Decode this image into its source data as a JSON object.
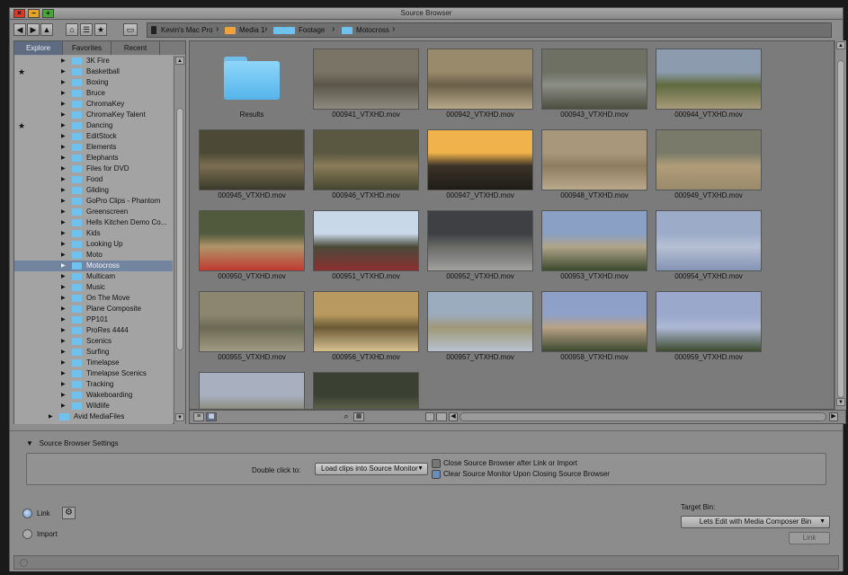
{
  "window": {
    "title": "Source Browser"
  },
  "breadcrumb": [
    {
      "label": "Kevin's Mac Pro",
      "icon": "hard-drive-icon"
    },
    {
      "label": "Media 1",
      "icon": "folder-orange-icon"
    },
    {
      "label": "",
      "icon": "folder-icon"
    },
    {
      "label": "Footage",
      "icon": "folder-icon"
    },
    {
      "label": "Motocross",
      "icon": "folder-icon"
    }
  ],
  "tabs": [
    "Explore",
    "Favorites",
    "Recent"
  ],
  "tree": [
    {
      "label": "3K Fire",
      "star": false
    },
    {
      "label": "Basketball",
      "star": true
    },
    {
      "label": "Boxing",
      "star": false
    },
    {
      "label": "Bruce",
      "star": false
    },
    {
      "label": "ChromaKey",
      "star": false
    },
    {
      "label": "ChromaKey Talent",
      "star": false
    },
    {
      "label": "Dancing",
      "star": true
    },
    {
      "label": "EditStock",
      "star": false
    },
    {
      "label": "Elements",
      "star": false
    },
    {
      "label": "Elephants",
      "star": false
    },
    {
      "label": "Files for DVD",
      "star": false
    },
    {
      "label": "Food",
      "star": false
    },
    {
      "label": "Gliding",
      "star": false
    },
    {
      "label": "GoPro Clips - Phantom",
      "star": false
    },
    {
      "label": "Greenscreen",
      "star": false
    },
    {
      "label": "Hells Kitchen Demo Co...",
      "star": false
    },
    {
      "label": "Kids",
      "star": false
    },
    {
      "label": "Looking Up",
      "star": false
    },
    {
      "label": "Moto",
      "star": false
    },
    {
      "label": "Motocross",
      "star": false,
      "selected": true
    },
    {
      "label": "Multicam",
      "star": false
    },
    {
      "label": "Music",
      "star": false
    },
    {
      "label": "On The Move",
      "star": false
    },
    {
      "label": "Plane Composite",
      "star": false
    },
    {
      "label": "PP101",
      "star": false
    },
    {
      "label": "ProRes 4444",
      "star": false
    },
    {
      "label": "Scenics",
      "star": false
    },
    {
      "label": "Surfing",
      "star": false
    },
    {
      "label": "Timelapse",
      "star": false
    },
    {
      "label": "Timelapse Scenics",
      "star": false
    },
    {
      "label": "Tracking",
      "star": false
    },
    {
      "label": "Wakeboarding",
      "star": false
    },
    {
      "label": "Wildlife",
      "star": false
    },
    {
      "label": "Avid MediaFiles",
      "star": false,
      "outdent": true
    }
  ],
  "items": [
    {
      "name": "Results",
      "type": "folder"
    },
    {
      "name": "000941_VTXHD.mov",
      "type": "clip",
      "colors": [
        "#7a7466",
        "#5b5648",
        "#8e8a80"
      ]
    },
    {
      "name": "000942_VTXHD.mov",
      "type": "clip",
      "colors": [
        "#9a8a6c",
        "#6b5f48",
        "#b7a88a"
      ]
    },
    {
      "name": "000943_VTXHD.mov",
      "type": "clip",
      "colors": [
        "#6d7062",
        "#8c8e86",
        "#4d4f40"
      ]
    },
    {
      "name": "000944_VTXHD.mov",
      "type": "clip",
      "colors": [
        "#8c9cae",
        "#5f6a3e",
        "#a79a7a"
      ]
    },
    {
      "name": "000945_VTXHD.mov",
      "type": "clip",
      "colors": [
        "#4c4a36",
        "#7b6e52",
        "#3a3a2a"
      ]
    },
    {
      "name": "000946_VTXHD.mov",
      "type": "clip",
      "colors": [
        "#5a5840",
        "#8a7c5a",
        "#45462f"
      ]
    },
    {
      "name": "000947_VTXHD.mov",
      "type": "clip",
      "colors": [
        "#f0b24a",
        "#3a3328",
        "#1f1c18"
      ]
    },
    {
      "name": "000948_VTXHD.mov",
      "type": "clip",
      "colors": [
        "#a8977a",
        "#8d7c60",
        "#b9a88c"
      ]
    },
    {
      "name": "000949_VTXHD.mov",
      "type": "clip",
      "colors": [
        "#7a7a6a",
        "#b09c78",
        "#9a8a6c"
      ]
    },
    {
      "name": "000950_VTXHD.mov",
      "type": "clip",
      "colors": [
        "#525a3e",
        "#b0956a",
        "#c03a30"
      ]
    },
    {
      "name": "000951_VTXHD.mov",
      "type": "clip",
      "colors": [
        "#c8d8e8",
        "#4a4a3a",
        "#8c3030"
      ]
    },
    {
      "name": "000952_VTXHD.mov",
      "type": "clip",
      "colors": [
        "#3e4044",
        "#6a6a66",
        "#a0a0a0"
      ]
    },
    {
      "name": "000953_VTXHD.mov",
      "type": "clip",
      "colors": [
        "#8aa0c4",
        "#b0a48a",
        "#3d4a2e"
      ]
    },
    {
      "name": "000954_VTXHD.mov",
      "type": "clip",
      "colors": [
        "#9cacc8",
        "#b6c0d4",
        "#8494b4"
      ]
    },
    {
      "name": "000955_VTXHD.mov",
      "type": "clip",
      "colors": [
        "#8c8670",
        "#6c6a54",
        "#a09a84"
      ]
    },
    {
      "name": "000956_VTXHD.mov",
      "type": "clip",
      "colors": [
        "#b89a60",
        "#6a5a36",
        "#d8c090"
      ]
    },
    {
      "name": "000957_VTXHD.mov",
      "type": "clip",
      "colors": [
        "#9cacbf",
        "#a09878",
        "#b8c2d0"
      ]
    },
    {
      "name": "000958_VTXHD.mov",
      "type": "clip",
      "colors": [
        "#8ea0c8",
        "#b8a286",
        "#3e4a30"
      ]
    },
    {
      "name": "000959_VTXHD.mov",
      "type": "clip",
      "colors": [
        "#9aa8cc",
        "#aeb8d4",
        "#3c4a2e"
      ]
    },
    {
      "name": "",
      "type": "clip",
      "colors": [
        "#a8b0c0",
        "#8c8c80",
        "#c0c4cc"
      ]
    },
    {
      "name": "",
      "type": "clip",
      "colors": [
        "#3a4032",
        "#5a6048",
        "#2a2e24"
      ]
    }
  ],
  "settings": {
    "heading": "Source Browser Settings",
    "double_click_label": "Double click to:",
    "double_click_value": "Load clips into Source Monitor",
    "check1": "Close Source Browser after Link or Import",
    "check2": "Clear Source Monitor Upon Closing Source Browser",
    "radio_link": "Link",
    "radio_import": "Import",
    "target_bin_label": "Target Bin:",
    "target_bin_value": "Lets Edit with Media Composer Bin",
    "link_button": "Link"
  },
  "toolbar": {
    "back": "◀",
    "forward": "▶",
    "up": "▲",
    "home": "⌂",
    "list": "☰",
    "star": "★",
    "drive": "▭"
  },
  "window_buttons": {
    "close": "×",
    "minimize": "−",
    "zoom": "+"
  }
}
